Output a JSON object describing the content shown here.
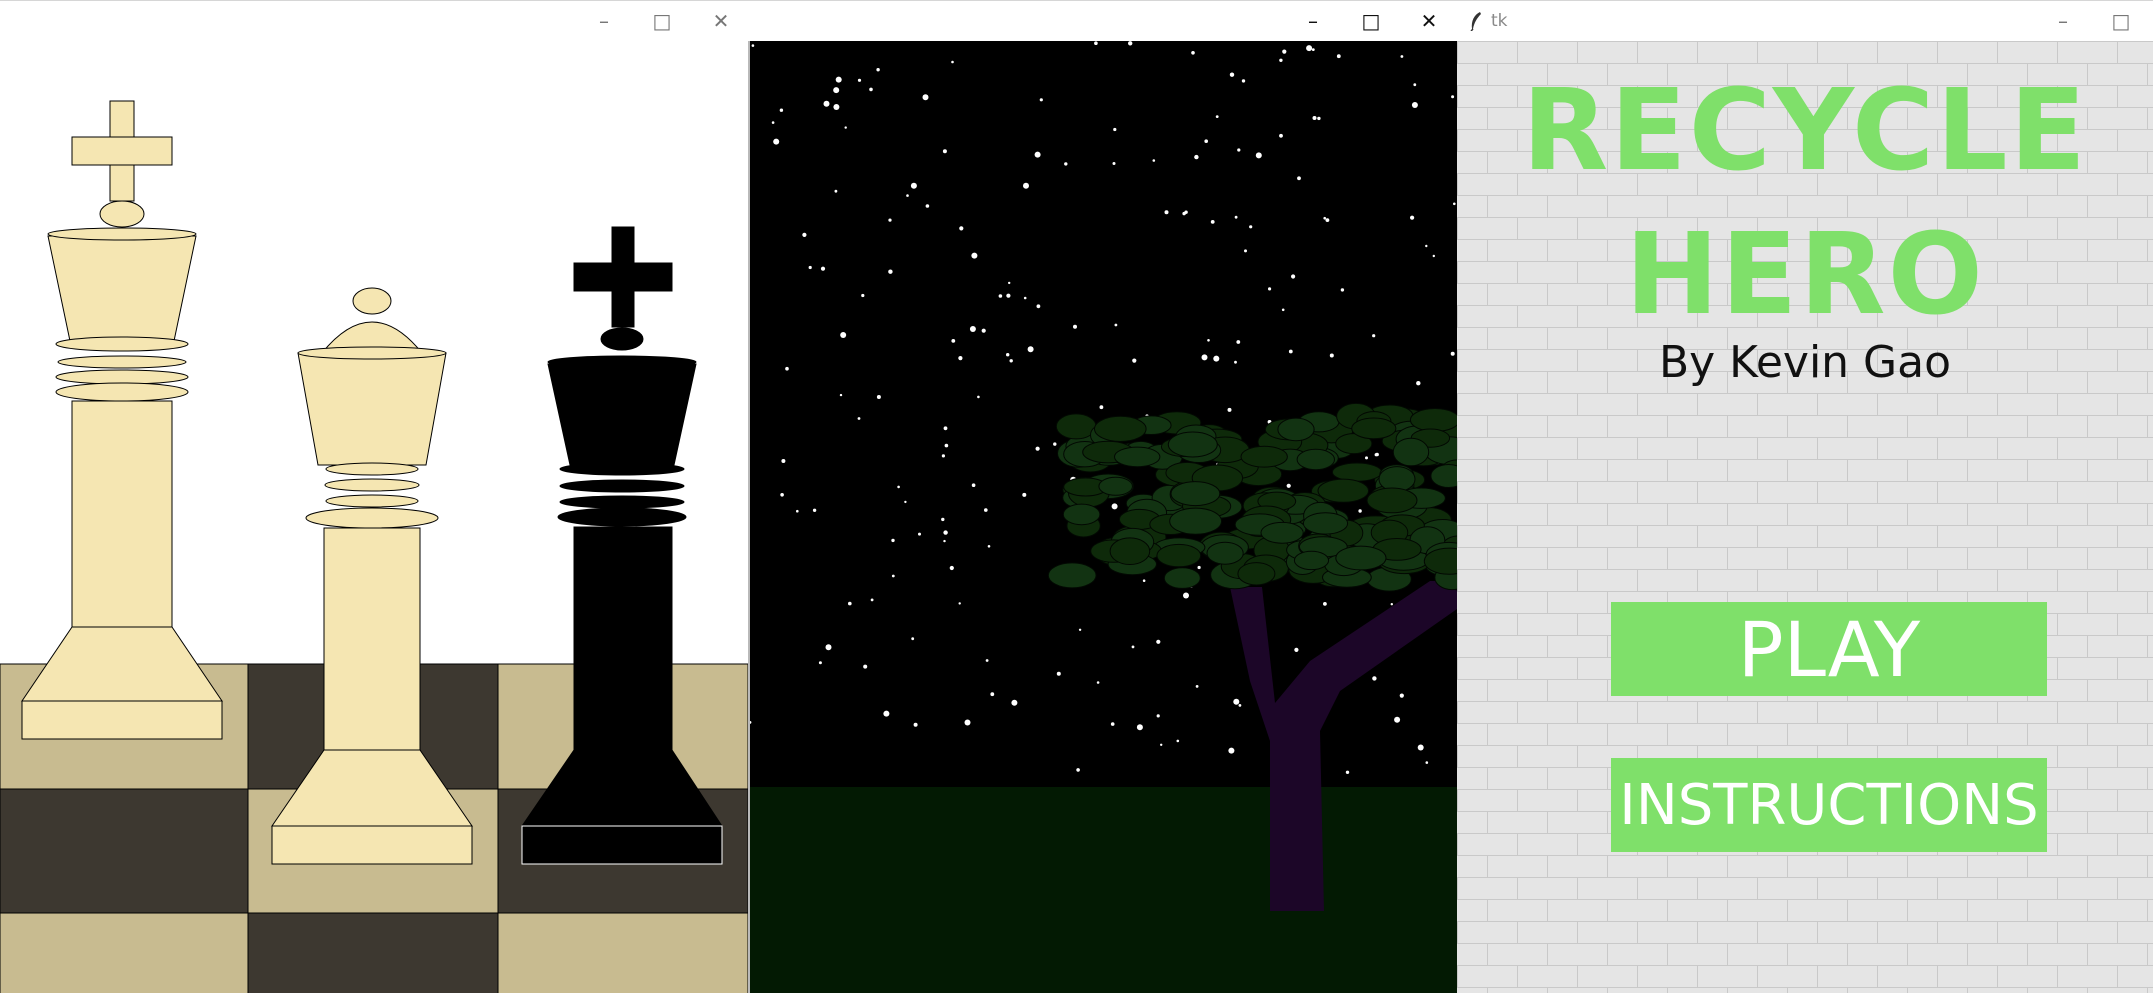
{
  "windows": [
    {
      "id": "chess",
      "titlebar": {
        "title": "",
        "controls": [
          "minimize-icon",
          "maximize-icon",
          "close-icon"
        ]
      },
      "colors": {
        "light_piece": "#f5e6b2",
        "dark_piece": "#000000",
        "light_square": "#c8bb90",
        "dark_square": "#3d3830"
      }
    },
    {
      "id": "night",
      "titlebar": {
        "title": "",
        "controls": [
          "minimize-icon",
          "maximize-icon",
          "close-icon"
        ]
      },
      "colors": {
        "sky": "#000000",
        "ground": "#031a03",
        "trunk": "#1c0628",
        "leaves": "#0e2a0a"
      }
    },
    {
      "id": "menu",
      "titlebar": {
        "title": "tk",
        "app_icon": "feather-icon",
        "controls": [
          "minimize-icon",
          "maximize-icon"
        ]
      },
      "title_line1": "RECYCLE",
      "title_line2": "HERO",
      "byline": "By Kevin Gao",
      "play_label": "PLAY",
      "instructions_label": "INSTRUCTIONS",
      "colors": {
        "accent": "#7fe06a",
        "brick": "#e5e5e5",
        "mortar": "#c9c9c9"
      }
    }
  ]
}
